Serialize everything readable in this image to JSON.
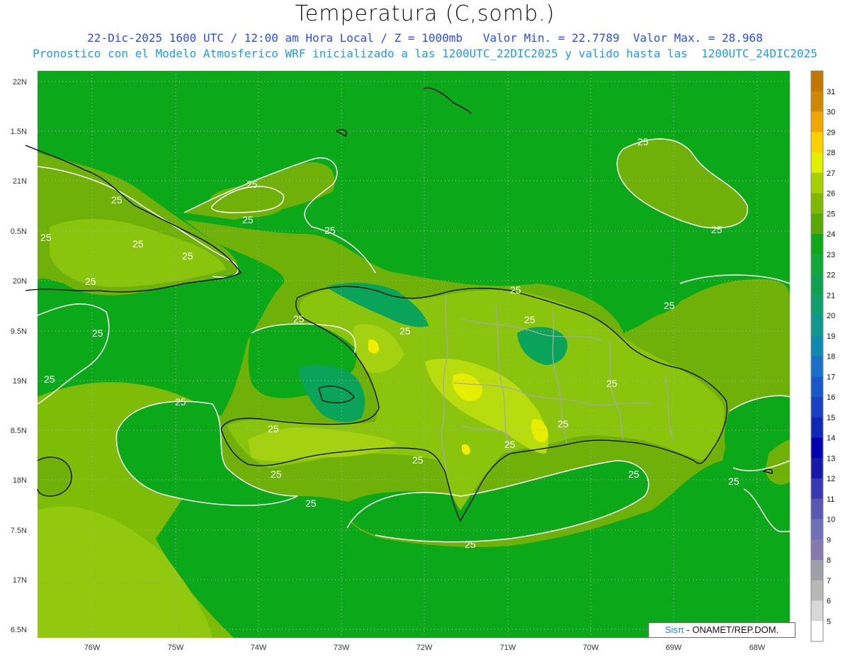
{
  "title": "Temperatura (C,somb.)",
  "subtitle1": "22-Dic-2025 1600 UTC / 12:00 am Hora Local / Z = 1000mb   Valor Min. = 22.7789  Valor Max. = 28.968",
  "subtitle2": "Pronostico con el Modelo Atmosferico WRF inicializado a las 1200UTC_22DIC2025 y valido hasta las  1200UTC_24DIC2025",
  "lat_labels": [
    "22N",
    "1.5N",
    "21N",
    "0.5N",
    "20N",
    "9.5N",
    "19N",
    "8.5N",
    "18N",
    "7.5N",
    "17N",
    "6.5N"
  ],
  "lon_labels": [
    "76W",
    "75W",
    "74W",
    "73W",
    "72W",
    "71W",
    "70W",
    "69W",
    "68W"
  ],
  "contour_labels": [
    "25",
    "25",
    "25",
    "25",
    "25",
    "25",
    "25",
    "25",
    "25",
    "25",
    "25",
    "25",
    "25",
    "25",
    "25",
    "25",
    "25",
    "25",
    "25",
    "25",
    "25",
    "25",
    "25",
    "25",
    "25",
    "25",
    "25",
    "25"
  ],
  "colorbar": {
    "labels": [
      "5",
      "6",
      "7",
      "8",
      "9",
      "10",
      "11",
      "12",
      "13",
      "14",
      "15",
      "16",
      "17",
      "18",
      "19",
      "20",
      "21",
      "22",
      "23",
      "24",
      "25",
      "26",
      "27",
      "28",
      "29",
      "30",
      "31"
    ],
    "colors": [
      "#ffffff",
      "#d8d8d8",
      "#b8b8b8",
      "#a0a0a8",
      "#8878b0",
      "#7070b8",
      "#5858b0",
      "#3838b0",
      "#1818a8",
      "#0000b0",
      "#1028b8",
      "#1840c0",
      "#1858c8",
      "#1870c8",
      "#1088b0",
      "#109890",
      "#10a070",
      "#10a050",
      "#10a838",
      "#10a818",
      "#58a808",
      "#80b800",
      "#a8d000",
      "#e0f000",
      "#ffd000",
      "#f0a800",
      "#d08800",
      "#c07800"
    ]
  },
  "credit": {
    "brand": "Sisπ",
    "text": " - ONAMET/REP.DOM."
  },
  "colors": {
    "sea": "#0ba81a",
    "land_low": "#6fb108",
    "land_mid": "#8bc40d",
    "land_high": "#b8dc0e",
    "peak": "#f2ee00",
    "wet": "#0aa35a"
  }
}
